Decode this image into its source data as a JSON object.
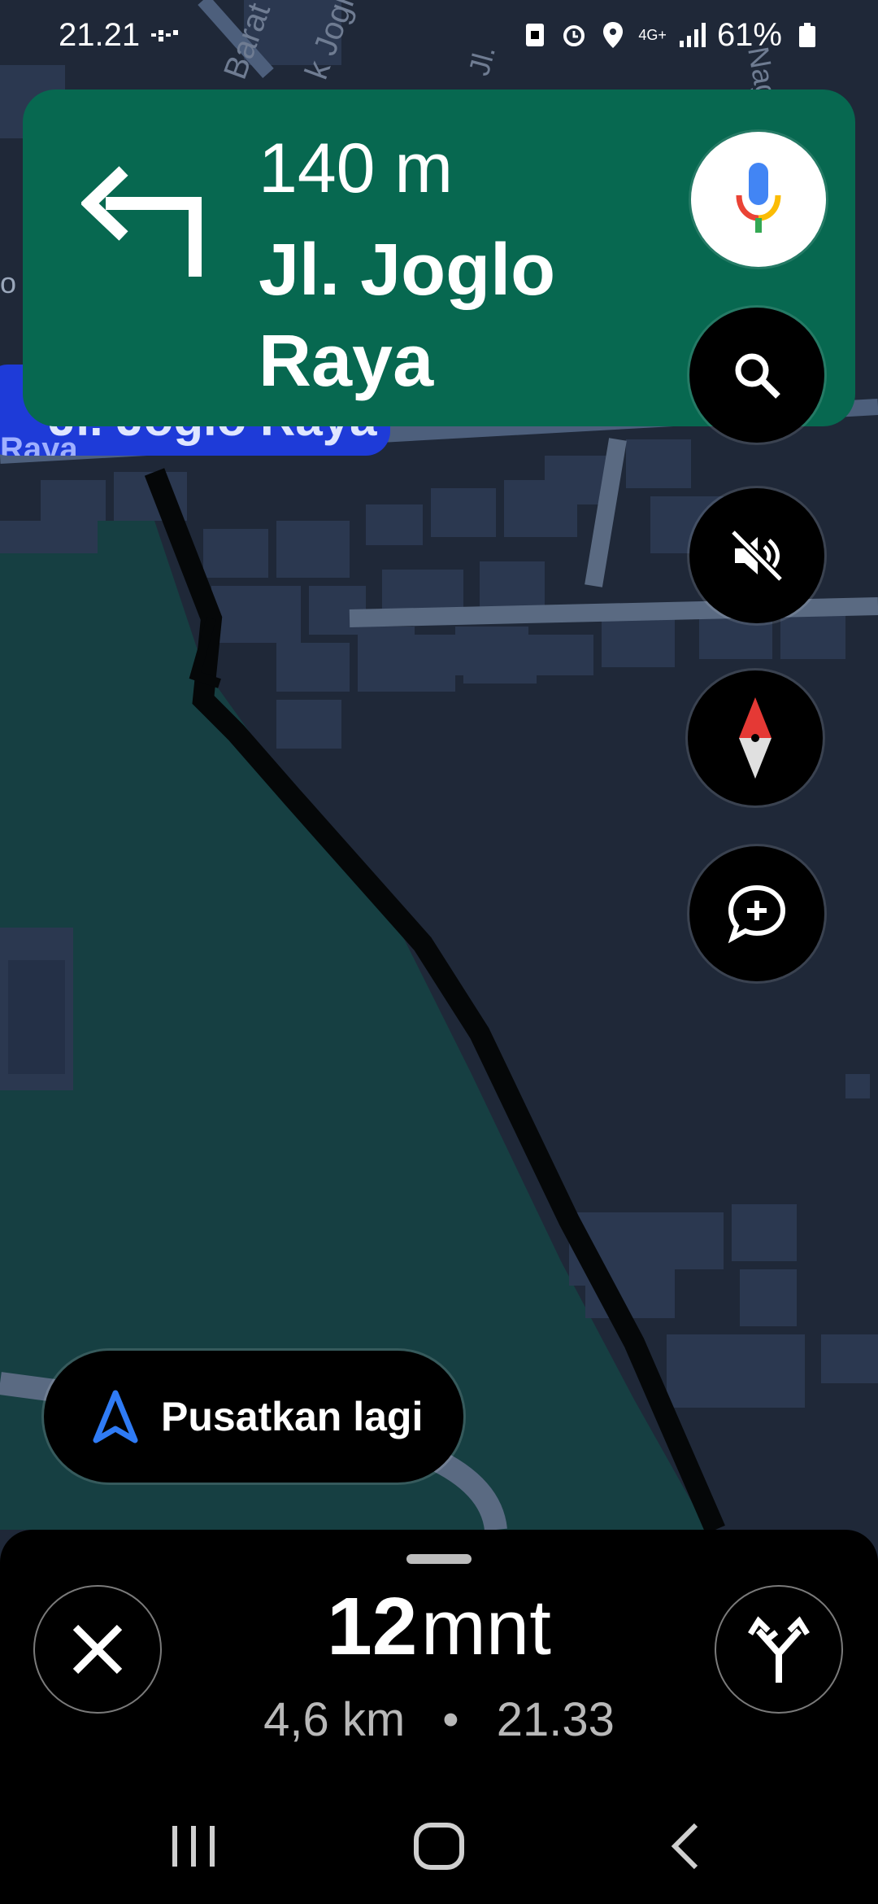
{
  "status_bar": {
    "time": "21.21",
    "network_type": "4G+",
    "battery_percent": "61%",
    "icons": [
      "sim-icon",
      "alarm-icon",
      "location-icon",
      "signal-icon",
      "battery-icon"
    ]
  },
  "map_labels": {
    "road_label_1": "Barat",
    "road_label_2": "k Joglo",
    "road_label_3": "Jl.",
    "road_label_4": "Nagas",
    "road_label_5": "o",
    "current_street_chip": "Jl. Joglo Raya",
    "current_street_sub": "Raya"
  },
  "navigation": {
    "distance": "140 m",
    "street": "Jl. Joglo Raya",
    "maneuver_icon": "turn-left-icon"
  },
  "controls": {
    "voice_icon": "microphone-icon",
    "search_icon": "search-icon",
    "mute_icon": "sound-off-icon",
    "compass_icon": "compass-icon",
    "report_icon": "add-report-icon"
  },
  "recenter": {
    "label": "Pusatkan lagi",
    "icon": "navigation-arrow-icon"
  },
  "trip": {
    "eta_minutes": "12",
    "eta_unit": "mnt",
    "distance": "4,6 km",
    "separator": "•",
    "arrival_time": "21.33"
  },
  "colors": {
    "nav_card": "#076850",
    "map_background": "#1f2838",
    "park_green": "#163f42",
    "chip_blue": "#1e3bd8"
  }
}
